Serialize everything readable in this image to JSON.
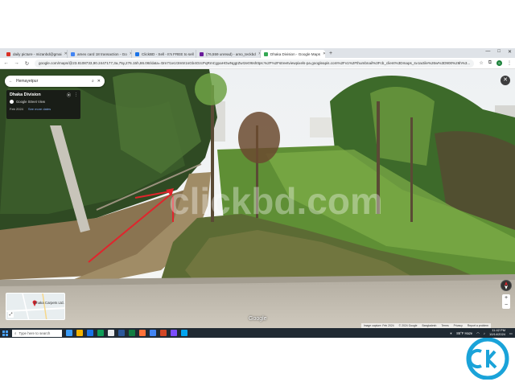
{
  "browser": {
    "tabs": [
      {
        "label": "daily picture - mizanbd@gmai",
        "color": "#d93025",
        "active": false
      },
      {
        "label": "amex card 18 transaction - Go",
        "color": "#4285f4",
        "active": false
      },
      {
        "label": "ClickBD - Sell - It's FREE to sell",
        "color": "#1a73e8",
        "active": false
      },
      {
        "label": "(76,559 unread) - amo_teckbd",
        "color": "#6a1b9a",
        "active": false
      },
      {
        "label": "Dhaka Division - Google Maps",
        "color": "#34a853",
        "active": true
      }
    ],
    "new_tab": "+",
    "window_controls": [
      "—",
      "□",
      "✕"
    ],
    "url": "google.com/maps/@23.8108733,90.2447177,3a,75y,276.15h,86.06t/data=!3m7!1e1!3m5!1sGb4OzcPqRmCgpaHGwNggIZw!2e0!6shttps:%2F%2Fstreetviewpixels-pa.googleapis.com%2Fv1%2Fthumbnail%3Fcb_client%3Dmaps_sv.tactile%26w%3D900%26h%3...",
    "profile_initial": "S"
  },
  "street_view": {
    "search_value": "Hemayetpur",
    "place_title": "Dhaka Division",
    "source": "Google Street View",
    "capture_date": "Feb 2024",
    "more_dates_link": "See more dates",
    "google_label": "Google",
    "minimap_label": "Dhaka Carpets Ltd.",
    "attribution": [
      "Image capture: Feb 2024",
      "© 2024 Google",
      "Bangladesh",
      "Terms",
      "Privacy",
      "Report a problem"
    ],
    "watermark_text": "clickbd.com",
    "zoom_in": "+",
    "zoom_out": "−",
    "close_symbol": "✕"
  },
  "taskbar": {
    "search_placeholder": "Type here to search",
    "weather": "86°F  Haze",
    "time": "11:42 PM",
    "date": "10/14/2024",
    "app_icon_colors": [
      "#3b9cf7",
      "#f4b400",
      "#1a73e8",
      "#0f9d58",
      "#e8eaed",
      "#2b579a",
      "#107c41",
      "#ff7139",
      "#4285f4",
      "#d24726",
      "#7b4dff",
      "#00a4ef"
    ]
  },
  "colors": {
    "brand_watermark": "#1aa3d9",
    "arrow": "#e0252d"
  }
}
